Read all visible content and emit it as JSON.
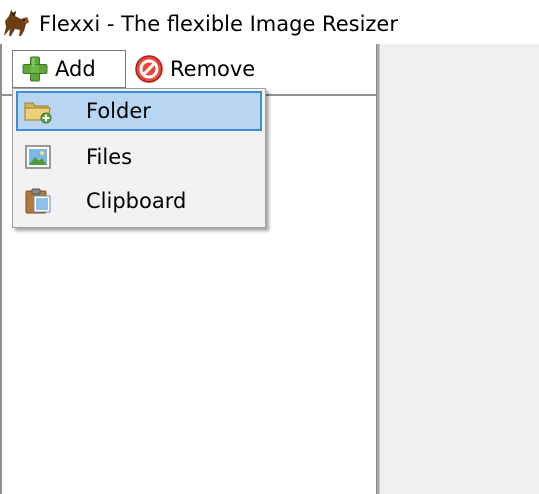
{
  "window": {
    "title": "Flexxi - The flexible Image Resizer",
    "app_icon": "flexxi-horse-logo-icon"
  },
  "toolbar": {
    "add_label": "Add",
    "add_icon": "green-plus-icon",
    "remove_label": "Remove",
    "remove_icon": "red-no-entry-icon"
  },
  "add_menu": {
    "items": [
      {
        "label": "Folder",
        "icon": "folder-add-icon",
        "selected": true
      },
      {
        "label": "Files",
        "icon": "image-file-icon",
        "selected": false
      },
      {
        "label": "Clipboard",
        "icon": "clipboard-icon",
        "selected": false
      }
    ]
  },
  "colors": {
    "menu_highlight": "#b8d6f2",
    "menu_highlight_border": "#3c8fd6",
    "right_panel": "#f0f0f0"
  }
}
